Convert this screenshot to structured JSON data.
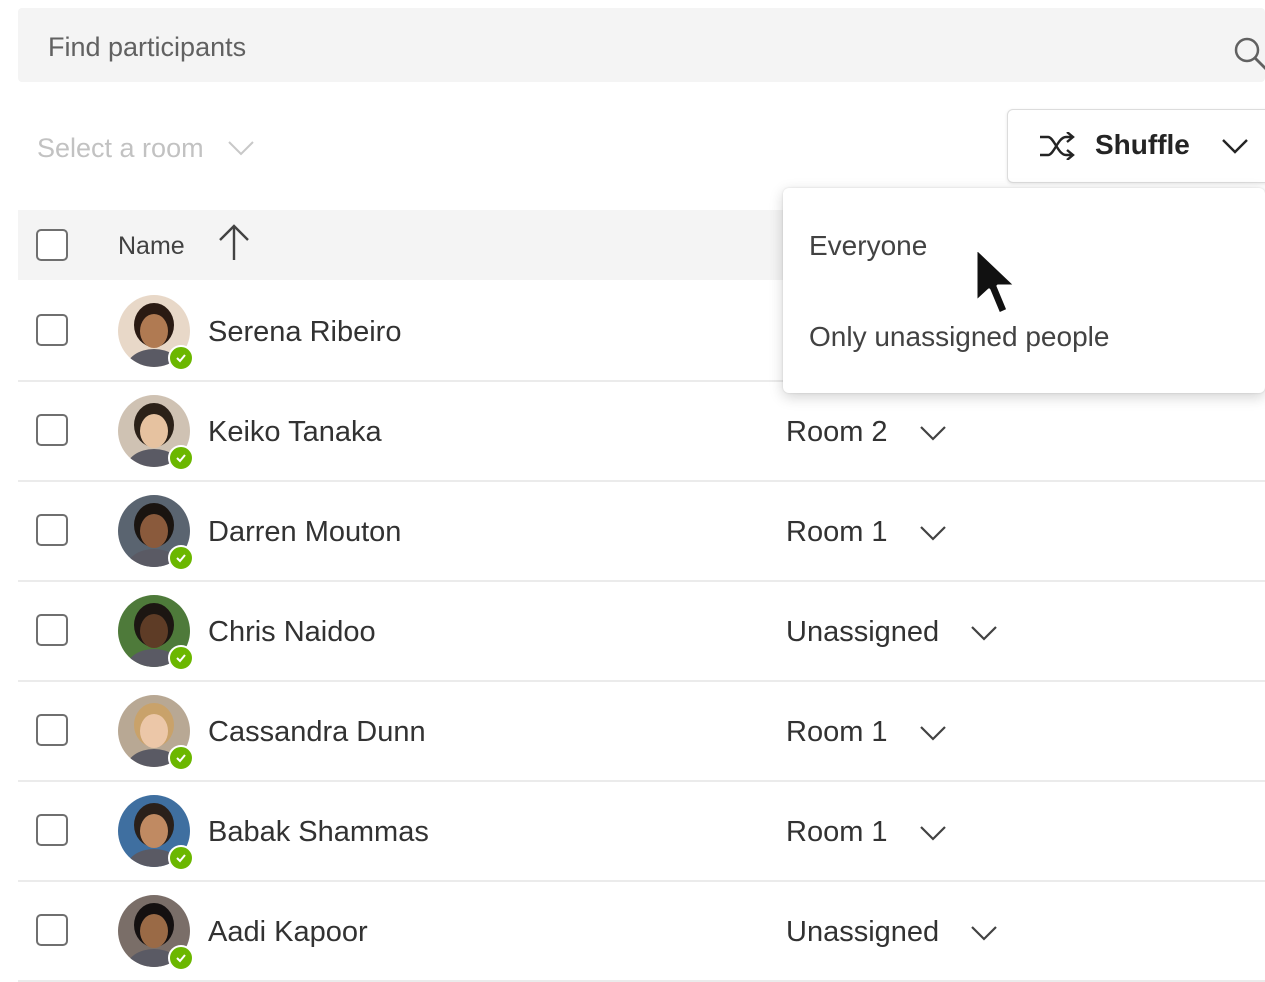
{
  "search": {
    "placeholder": "Find participants",
    "icon": "search-icon"
  },
  "room_filter": {
    "label": "Select a room"
  },
  "shuffle": {
    "label": "Shuffle",
    "icon": "shuffle-icon"
  },
  "table": {
    "header_name": "Name",
    "sort": "ascending"
  },
  "shuffle_menu": {
    "items": [
      {
        "label": "Everyone"
      },
      {
        "label": "Only unassigned people"
      }
    ]
  },
  "participants": [
    {
      "name": "Serena Ribeiro",
      "room": "",
      "skin": "#b07a52",
      "hair": "#2a1a12",
      "bg": "#e8d8c8"
    },
    {
      "name": "Keiko Tanaka",
      "room": "Room 2",
      "skin": "#e6c2a0",
      "hair": "#2b2118",
      "bg": "#cfc2b3"
    },
    {
      "name": "Darren Mouton",
      "room": "Room 1",
      "skin": "#8a5a3c",
      "hair": "#1a1410",
      "bg": "#5a6470"
    },
    {
      "name": "Chris Naidoo",
      "room": "Unassigned",
      "skin": "#5e3c26",
      "hair": "#1c1612",
      "bg": "#4e7a3a"
    },
    {
      "name": "Cassandra Dunn",
      "room": "Room 1",
      "skin": "#ecc7a8",
      "hair": "#c9a26a",
      "bg": "#b8a894"
    },
    {
      "name": "Babak Shammas",
      "room": "Room 1",
      "skin": "#c08a62",
      "hair": "#2a201a",
      "bg": "#3f6fa0"
    },
    {
      "name": "Aadi Kapoor",
      "room": "Unassigned",
      "skin": "#9a6a46",
      "hair": "#141010",
      "bg": "#7a6e68"
    }
  ],
  "colors": {
    "presence_available": "#6bb700",
    "header_bg": "#f4f4f4",
    "disabled_text": "#c2c2c2"
  }
}
